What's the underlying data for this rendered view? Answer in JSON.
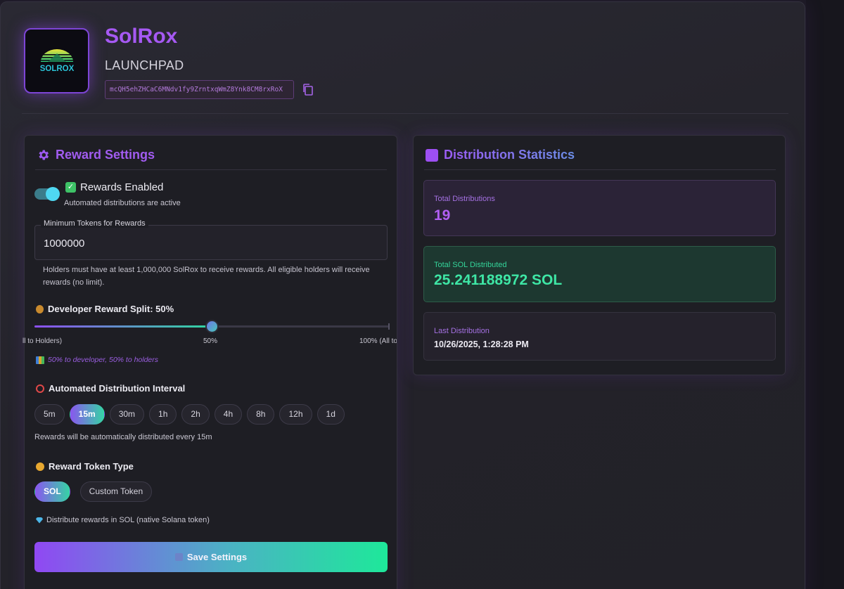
{
  "header": {
    "app_title": "SolRox",
    "subtitle": "LAUNCHPAD",
    "logo_text": "SOLROX",
    "address": "mcQH5ehZHCaC6MNdv1fy9ZrntxqWmZ8Ynk8CM8rxRoX"
  },
  "reward_settings": {
    "title": "Reward Settings",
    "title_icon": "gear-icon",
    "toggle_on": true,
    "rewards_enabled_label": "Rewards Enabled",
    "rewards_enabled_sub": "Automated distributions are active",
    "min_tokens_label": "Minimum Tokens for Rewards",
    "min_tokens_value": "1000000",
    "min_tokens_helper": "Holders must have at least 1,000,000 SolRox to receive rewards. All eligible holders will receive rewards (no limit).",
    "dev_split_label": "Developer Reward Split: 50%",
    "dev_split_percent": 50,
    "slider_left_label": "ll to Holders)",
    "slider_mid_label": "50%",
    "slider_right_label": "100% (All to",
    "split_note": "50% to developer, 50% to holders",
    "interval_label": "Automated Distribution Interval",
    "intervals": [
      "5m",
      "15m",
      "30m",
      "1h",
      "2h",
      "4h",
      "8h",
      "12h",
      "1d"
    ],
    "selected_interval": "15m",
    "interval_note": "Rewards will be automatically distributed every 15m",
    "token_type_label": "Reward Token Type",
    "token_types": [
      "SOL",
      "Custom Token"
    ],
    "selected_token_type": "SOL",
    "token_note": "Distribute rewards in SOL (native Solana token)",
    "save_label": "Save Settings"
  },
  "distribution_statistics": {
    "title": "Distribution Statistics",
    "total_distributions_label": "Total Distributions",
    "total_distributions_value": "19",
    "total_sol_label": "Total SOL Distributed",
    "total_sol_value": "25.241188972 SOL",
    "last_distribution_label": "Last Distribution",
    "last_distribution_value": "10/26/2025, 1:28:28 PM"
  },
  "colors": {
    "accent_purple": "#a659f3",
    "accent_green": "#1ee89a",
    "background": "#1b1a22"
  }
}
